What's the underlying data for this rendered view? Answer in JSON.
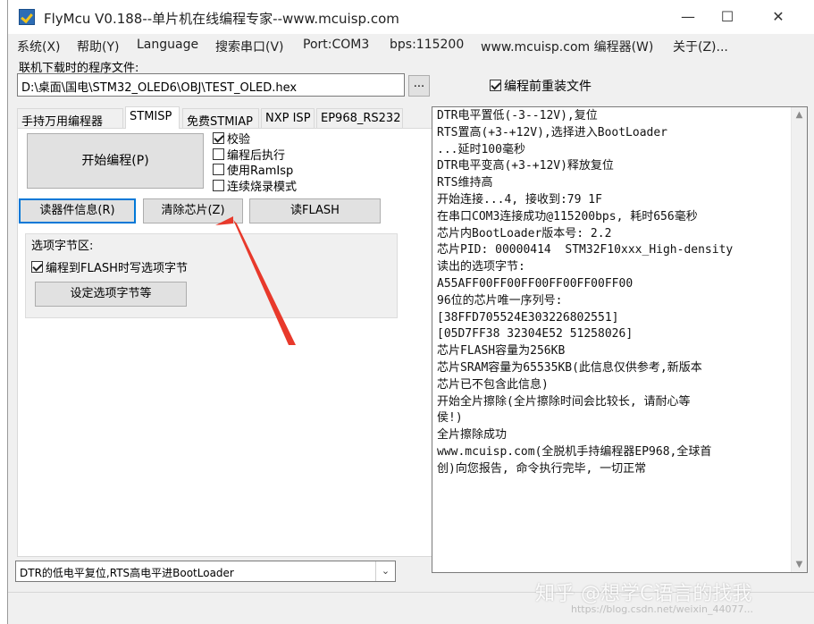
{
  "window": {
    "title": "FlyMcu V0.188--单片机在线编程专家--www.mcuisp.com",
    "minimize_glyph": "—",
    "maximize_glyph": "☐",
    "close_glyph": "✕"
  },
  "menu": {
    "items": [
      "系统(X)",
      "帮助(Y)",
      "Language",
      "搜索串口(V)",
      "Port:COM3",
      "bps:115200",
      "www.mcuisp.com 编程器(W)",
      "关于(Z)..."
    ]
  },
  "file": {
    "label": "联机下载时的程序文件:",
    "path": "D:\\桌面\\国电\\STM32_OLED6\\OBJ\\TEST_OLED.hex",
    "browse_label": "...",
    "reload_label": "编程前重装文件",
    "reload_checked": true
  },
  "tabs": [
    "手持万用编程器",
    "STMISP",
    "免费STMIAP",
    "NXP ISP",
    "EP968_RS232"
  ],
  "stmisp": {
    "start_button": "开始编程(P)",
    "options": [
      {
        "label": "校验",
        "checked": true
      },
      {
        "label": "编程后执行",
        "checked": false
      },
      {
        "label": "使用RamIsp",
        "checked": false
      },
      {
        "label": "连续烧录模式",
        "checked": false
      }
    ],
    "read_info_button": "读器件信息(R)",
    "erase_button": "清除芯片(Z)",
    "read_flash_button": "读FLASH",
    "option_group": {
      "title": "选项字节区:",
      "write_option_label": "编程到FLASH时写选项字节",
      "write_option_checked": true,
      "set_option_button": "设定选项字节等"
    }
  },
  "reset_mode": {
    "selected": "DTR的低电平复位,RTS高电平进BootLoader"
  },
  "log": {
    "lines": [
      "DTR电平置低(-3--12V),复位",
      "RTS置高(+3-+12V),选择进入BootLoader",
      "...延时100毫秒",
      "DTR电平变高(+3-+12V)释放复位",
      "RTS维持高",
      "开始连接...4, 接收到:79 1F",
      "在串口COM3连接成功@115200bps, 耗时656毫秒",
      "芯片内BootLoader版本号: 2.2",
      "芯片PID: 00000414  STM32F10xxx_High-density",
      "读出的选项字节:",
      "A55AFF00FF00FF00FF00FF00FF00",
      "96位的芯片唯一序列号:",
      "[38FFD705524E303226802551]",
      "[05D7FF38 32304E52 51258026]",
      "芯片FLASH容量为256KB",
      "芯片SRAM容量为65535KB(此信息仅供参考,新版本",
      "芯片已不包含此信息)",
      "开始全片擦除(全片擦除时间会比较长, 请耐心等",
      "侯!)",
      "全片擦除成功",
      "www.mcuisp.com(全脱机手持编程器EP968,全球首",
      "创)向您报告, 命令执行完毕, 一切正常"
    ]
  },
  "watermark": {
    "text": "知乎 @想学C语言的找我",
    "url": "https://blog.csdn.net/weixin_44077..."
  },
  "colors": {
    "accent": "#0078d7",
    "annotation_arrow": "#e8392b"
  },
  "icons": {
    "app": "flymcu-logo-icon",
    "dropdown": "chevron-down-icon",
    "annotation": "red-arrow-annotation"
  }
}
